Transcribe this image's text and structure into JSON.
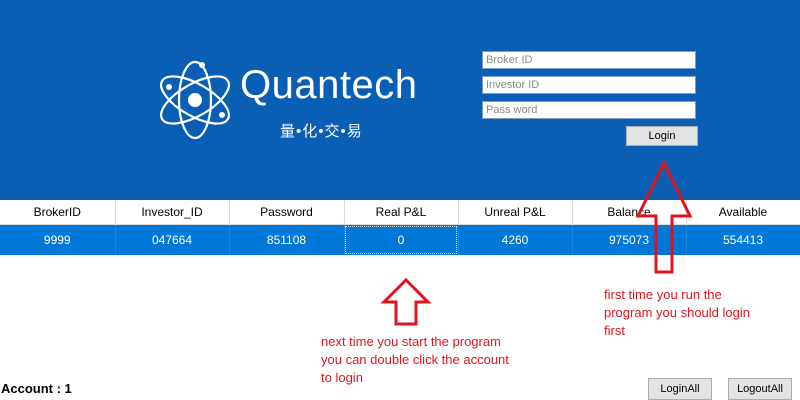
{
  "logo": {
    "brand": "Quantech",
    "subtitle": "量•化•交•易"
  },
  "form": {
    "broker_placeholder": "Broker ID",
    "investor_placeholder": "Investor ID",
    "password_placeholder": "Pass word",
    "login_label": "Login"
  },
  "table": {
    "headers": [
      "BrokerID",
      "Investor_ID",
      "Password",
      "Real P&L",
      "Unreal P&L",
      "Balance",
      "Available"
    ],
    "rows": [
      [
        "9999",
        "047664",
        "851108",
        "0",
        "4260",
        "975073",
        "554413"
      ]
    ]
  },
  "annotations": {
    "login_first": "first time you run the program you should login first",
    "double_click": "next time you start the program you can double click the account to login",
    "color": "#e0141e"
  },
  "footer": {
    "account_text": "Account : 1",
    "login_all": "LoginAll",
    "logout_all": "LogoutAll"
  },
  "colors": {
    "header_bg": "#0a5fb4",
    "row_selected": "#0078d7"
  }
}
